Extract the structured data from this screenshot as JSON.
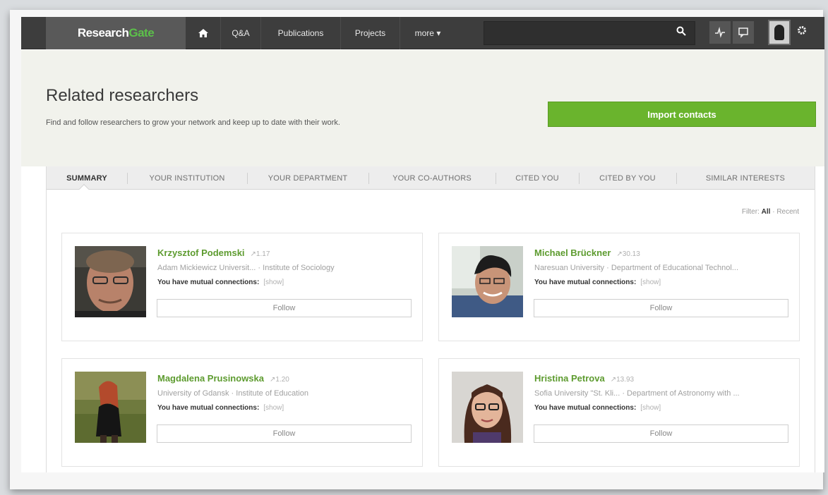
{
  "nav": {
    "logo_research": "Research",
    "logo_gate": "Gate",
    "home_icon": "home-icon",
    "items": [
      "Q&A",
      "Publications",
      "Projects",
      "more ▾"
    ],
    "search_icon": "search-icon",
    "pulse_icon": "activity-icon",
    "message_icon": "message-icon",
    "gear_icon": "gear-icon"
  },
  "header": {
    "title": "Related researchers",
    "subtitle": "Find and follow researchers to grow your network and keep up to date with their work.",
    "import_label": "Import contacts"
  },
  "tabs": [
    "SUMMARY",
    "YOUR INSTITUTION",
    "YOUR DEPARTMENT",
    "YOUR CO-AUTHORS",
    "CITED YOU",
    "CITED BY YOU",
    "SIMILAR INTERESTS"
  ],
  "filter": {
    "prefix": "Filter:",
    "all": "All",
    "sep": "·",
    "recent": "Recent"
  },
  "researchers": [
    {
      "name": "Krzysztof Podemski",
      "score": "↗1.17",
      "affiliation": "Adam Mickiewicz Universit... · Institute of Sociology",
      "mutual": "You have mutual connections:",
      "show": "[show]",
      "follow": "Follow"
    },
    {
      "name": "Michael Brückner",
      "score": "↗30.13",
      "affiliation": "Naresuan University · Department of Educational Technol...",
      "mutual": "You have mutual connections:",
      "show": "[show]",
      "follow": "Follow"
    },
    {
      "name": "Magdalena Prusinowska",
      "score": "↗1.20",
      "affiliation": "University of Gdansk · Institute of Education",
      "mutual": "You have mutual connections:",
      "show": "[show]",
      "follow": "Follow"
    },
    {
      "name": "Hristina Petrova",
      "score": "↗13.93",
      "affiliation": "Sofia University \"St. Kli... · Department of Astronomy with ...",
      "mutual": "You have mutual connections:",
      "show": "[show]",
      "follow": "Follow"
    }
  ],
  "colors": {
    "nav_bg": "#3d3d3d",
    "brand_green": "#5cc04a",
    "import_green": "#6ab42d",
    "name_green": "#5d9b2f"
  }
}
